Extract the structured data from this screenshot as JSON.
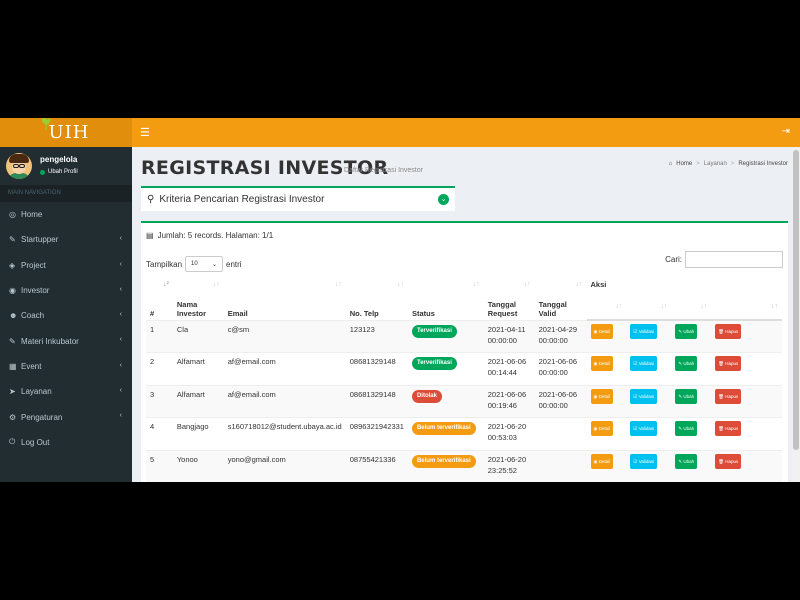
{
  "app": {
    "logo": "UIH"
  },
  "user": {
    "name": "pengelola",
    "status_label": "Ubah Profil"
  },
  "nav": {
    "header": "MAIN NAVIGATION",
    "items": [
      {
        "label": "Home",
        "icon": "dashboard-icon",
        "glyph": "◎",
        "chevron": false
      },
      {
        "label": "Startupper",
        "icon": "edit-icon",
        "glyph": "✎",
        "chevron": true
      },
      {
        "label": "Project",
        "icon": "cube-icon",
        "glyph": "◈",
        "chevron": true
      },
      {
        "label": "Investor",
        "icon": "eye-icon",
        "glyph": "◉",
        "chevron": true
      },
      {
        "label": "Coach",
        "icon": "users-icon",
        "glyph": "☻",
        "chevron": true
      },
      {
        "label": "Materi Inkubator",
        "icon": "edit-icon",
        "glyph": "✎",
        "chevron": true
      },
      {
        "label": "Event",
        "icon": "calendar-icon",
        "glyph": "▦",
        "chevron": true
      },
      {
        "label": "Layanan",
        "icon": "send-icon",
        "glyph": "➤",
        "chevron": true
      },
      {
        "label": "Pengaturan",
        "icon": "gears-icon",
        "glyph": "⚙",
        "chevron": true
      },
      {
        "label": "Log Out",
        "icon": "power-icon",
        "glyph": "⏻",
        "chevron": false
      }
    ]
  },
  "page": {
    "title": "REGISTRASI INVESTOR",
    "subtitle": "Daftar Registrasi Investor",
    "breadcrumb": {
      "home": "Home",
      "section": "Layanan",
      "current": "Registrasi Investor"
    }
  },
  "criteria": {
    "label": "Kriteria Pencarian Registrasi Investor"
  },
  "table_box": {
    "records": "Jumlah: 5 records. Halaman: 1/1",
    "show_label": "Tampilkan",
    "show_value": "10",
    "entries_label": "entri",
    "search_label": "Cari:",
    "search_value": ""
  },
  "table": {
    "headers": {
      "no": "#",
      "nama": "Nama Investor",
      "email": "Email",
      "telp": "No. Telp",
      "status": "Status",
      "request": "Tanggal Request",
      "valid": "Tanggal Valid",
      "aksi": "Aksi"
    },
    "actions": {
      "detail": "Detail",
      "validasi": "Validasi",
      "ubah": "Ubah",
      "hapus": "Hapus"
    },
    "rows": [
      {
        "no": "1",
        "nama": "Cla",
        "email": "c@sm",
        "telp": "123123",
        "status": "Terverifikasi",
        "status_color": "#00a65a",
        "req1": "2021-04-11",
        "req2": "00:00:00",
        "val1": "2021-04-29",
        "val2": "00:00:00"
      },
      {
        "no": "2",
        "nama": "Alfamart",
        "email": "af@email.com",
        "telp": "08681329148",
        "status": "Terverifikasi",
        "status_color": "#00a65a",
        "req1": "2021-06-06",
        "req2": "00:14:44",
        "val1": "2021-06-06",
        "val2": "00:00:00"
      },
      {
        "no": "3",
        "nama": "Alfamart",
        "email": "af@email.com",
        "telp": "08681329148",
        "status": "Ditolak",
        "status_color": "#dd4b39",
        "req1": "2021-06-06",
        "req2": "00:19:46",
        "val1": "2021-06-06",
        "val2": "00:00:00"
      },
      {
        "no": "4",
        "nama": "Bangjago",
        "email": "s160718012@student.ubaya.ac.id",
        "telp": "0896321942331",
        "status": "Belum terverifikasi",
        "status_color": "#f39c12",
        "req1": "2021-06-20",
        "req2": "00:53:03",
        "val1": "",
        "val2": ""
      },
      {
        "no": "5",
        "nama": "Yonoo",
        "email": "yono@gmail.com",
        "telp": "08755421336",
        "status": "Belum terverifikasi",
        "status_color": "#f39c12",
        "req1": "2021-06-20",
        "req2": "23:25:52",
        "val1": "",
        "val2": ""
      }
    ]
  },
  "colors": {
    "header": "#f39c12",
    "logo_bg": "#e08e0b",
    "sidebar": "#222d32",
    "accent_green": "#00a65a",
    "detail": "#f39c12",
    "validasi": "#00c0ef",
    "ubah": "#00a65a",
    "hapus": "#dd4b39"
  }
}
